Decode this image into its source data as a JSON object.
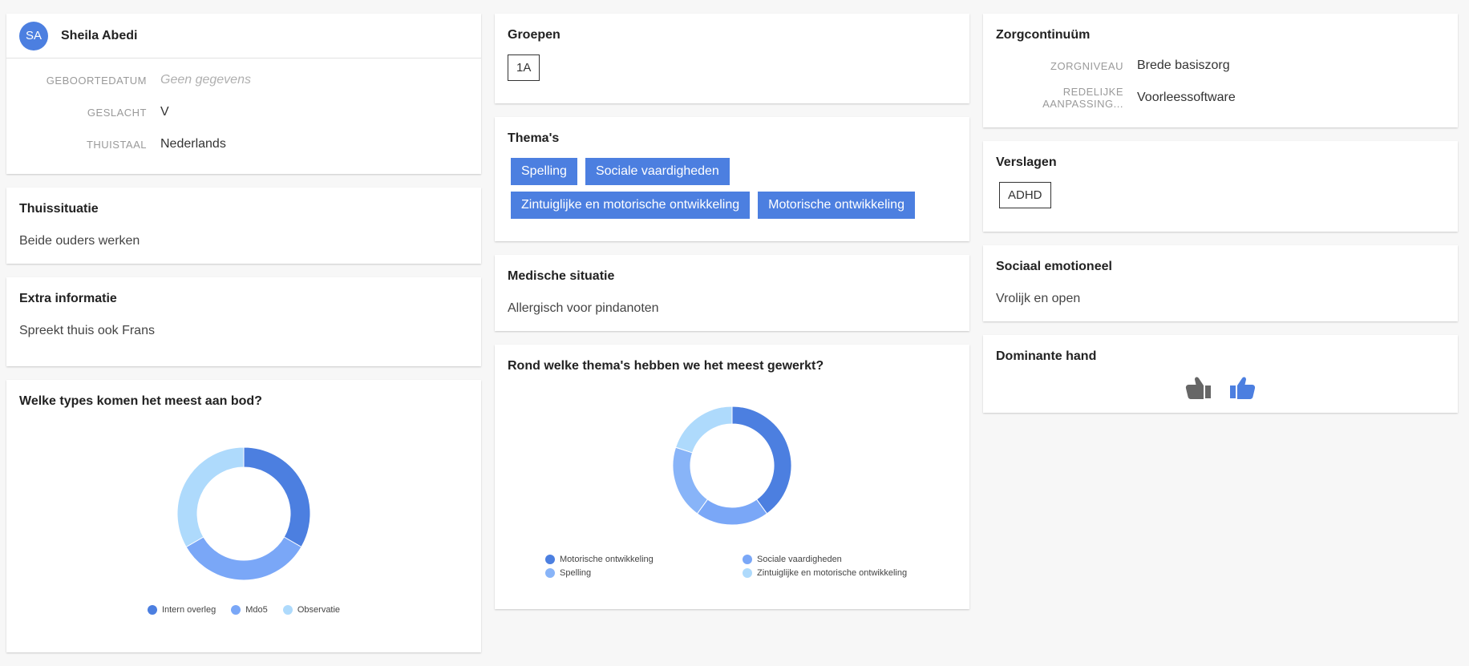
{
  "profile": {
    "initials": "SA",
    "name": "Sheila Abedi",
    "fields": [
      {
        "label": "GEBOORTEDATUM",
        "value": "Geen gegevens"
      },
      {
        "label": "GESLACHT",
        "value": "V"
      },
      {
        "label": "THUISTAAL",
        "value": "Nederlands"
      }
    ]
  },
  "thuissituatie": {
    "title": "Thuissituatie",
    "text": "Beide ouders werken"
  },
  "extra": {
    "title": "Extra informatie",
    "text": "Spreekt thuis ook Frans"
  },
  "types_chart": {
    "title": "Welke types komen het meest aan bod?",
    "legend": [
      "Intern overleg",
      "Mdo5",
      "Observatie"
    ]
  },
  "groepen": {
    "title": "Groepen",
    "items": [
      "1A"
    ]
  },
  "themas": {
    "title": "Thema's",
    "items": [
      "Spelling",
      "Sociale vaardigheden",
      "Zintuiglijke en motorische ontwikkeling",
      "Motorische ontwikkeling"
    ]
  },
  "medisch": {
    "title": "Medische situatie",
    "text": "Allergisch voor pindanoten"
  },
  "themas_chart": {
    "title": "Rond welke thema's hebben we het meest gewerkt?",
    "legend": [
      "Motorische ontwikkeling",
      "Sociale vaardigheden",
      "Spelling",
      "Zintuiglijke en motorische ontwikkeling"
    ]
  },
  "zorg": {
    "title": "Zorgcontinuüm",
    "fields": [
      {
        "label": "ZORGNIVEAU",
        "value": "Brede basiszorg"
      },
      {
        "label": "REDELIJKE AANPASSING...",
        "value": "Voorleessoftware"
      }
    ]
  },
  "verslagen": {
    "title": "Verslagen",
    "items": [
      "ADHD"
    ]
  },
  "sociaal": {
    "title": "Sociaal emotioneel",
    "text": "Vrolijk en open"
  },
  "hand": {
    "title": "Dominante hand",
    "left_icon": "thumbs-up-left-icon",
    "right_icon": "thumbs-up-right-icon",
    "selected": "right"
  },
  "colors": {
    "dark": "#4c7fe0",
    "mid": "#7aa7f7",
    "light": "#aedafc",
    "accent": "#4c7fe0",
    "inactive": "#666666"
  },
  "chart_data": [
    {
      "type": "pie",
      "title": "Welke types komen het meest aan bod?",
      "labels": [
        "Intern overleg",
        "Mdo5",
        "Observatie"
      ],
      "values": [
        33.3,
        33.3,
        33.3
      ],
      "donut": true
    },
    {
      "type": "pie",
      "title": "Rond welke thema's hebben we het meest gewerkt?",
      "labels": [
        "Motorische ontwikkeling",
        "Sociale vaardigheden",
        "Spelling",
        "Zintuiglijke en motorische ontwikkeling"
      ],
      "values": [
        40,
        20,
        20,
        20
      ],
      "donut": true
    }
  ]
}
